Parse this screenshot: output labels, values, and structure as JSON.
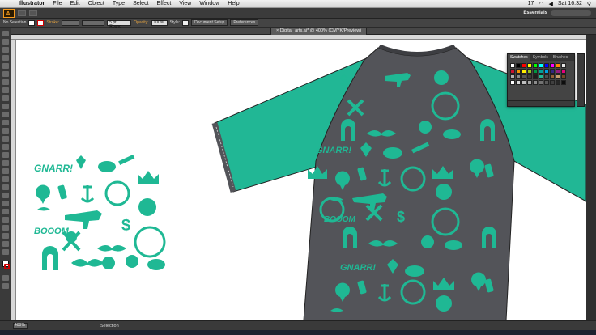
{
  "menubar": {
    "app_name": "Illustrator",
    "items": [
      "File",
      "Edit",
      "Object",
      "Type",
      "Select",
      "Effect",
      "View",
      "Window",
      "Help"
    ],
    "clock": "Sat 16:32",
    "badge": "17"
  },
  "appbar": {
    "logo": "Ai",
    "workspace": "Essentials"
  },
  "control": {
    "selection_label": "No Selection",
    "stroke_label": "Stroke:",
    "brush_value": "5 pt. Round",
    "opacity_label": "Opacity:",
    "opacity_value": "100%",
    "style_label": "Style:",
    "doc_setup_label": "Document Setup",
    "preferences_label": "Preferences"
  },
  "document": {
    "tab_title": "Digital_arts.ai* @ 400% (CMYK/Preview)"
  },
  "swatches_panel": {
    "tabs": [
      "Swatches",
      "Symbols",
      "Brushes"
    ],
    "active_tab": "Swatches",
    "colors": [
      "#ffffff",
      "#000000",
      "#ff0000",
      "#ffff00",
      "#00ff00",
      "#00ffff",
      "#0000ff",
      "#ff00ff",
      "#ff8800",
      "#e6e6e6",
      "#c8102e",
      "#f39200",
      "#ffed00",
      "#95c11f",
      "#009640",
      "#00a19a",
      "#009fe3",
      "#312783",
      "#951b81",
      "#e5007d",
      "#b2b2b2",
      "#878787",
      "#575756",
      "#3c3c3b",
      "#1d1d1b",
      "#21b795",
      "#4d4d4f",
      "#936037",
      "#c69c6d",
      "#754c24",
      "#ffffff",
      "#d9d9d9",
      "#bfbfbf",
      "#a6a6a6",
      "#8c8c8c",
      "#737373",
      "#595959",
      "#404040",
      "#262626",
      "#0d0d0d"
    ]
  },
  "artwork": {
    "jersey_body_color": "#535459",
    "sleeve_color": "#21b795",
    "motif_color": "#1fb894",
    "comic_word_1": "GNARR!",
    "comic_word_2": "BOOOM"
  },
  "status": {
    "zoom": "400%",
    "tool": "Selection"
  }
}
